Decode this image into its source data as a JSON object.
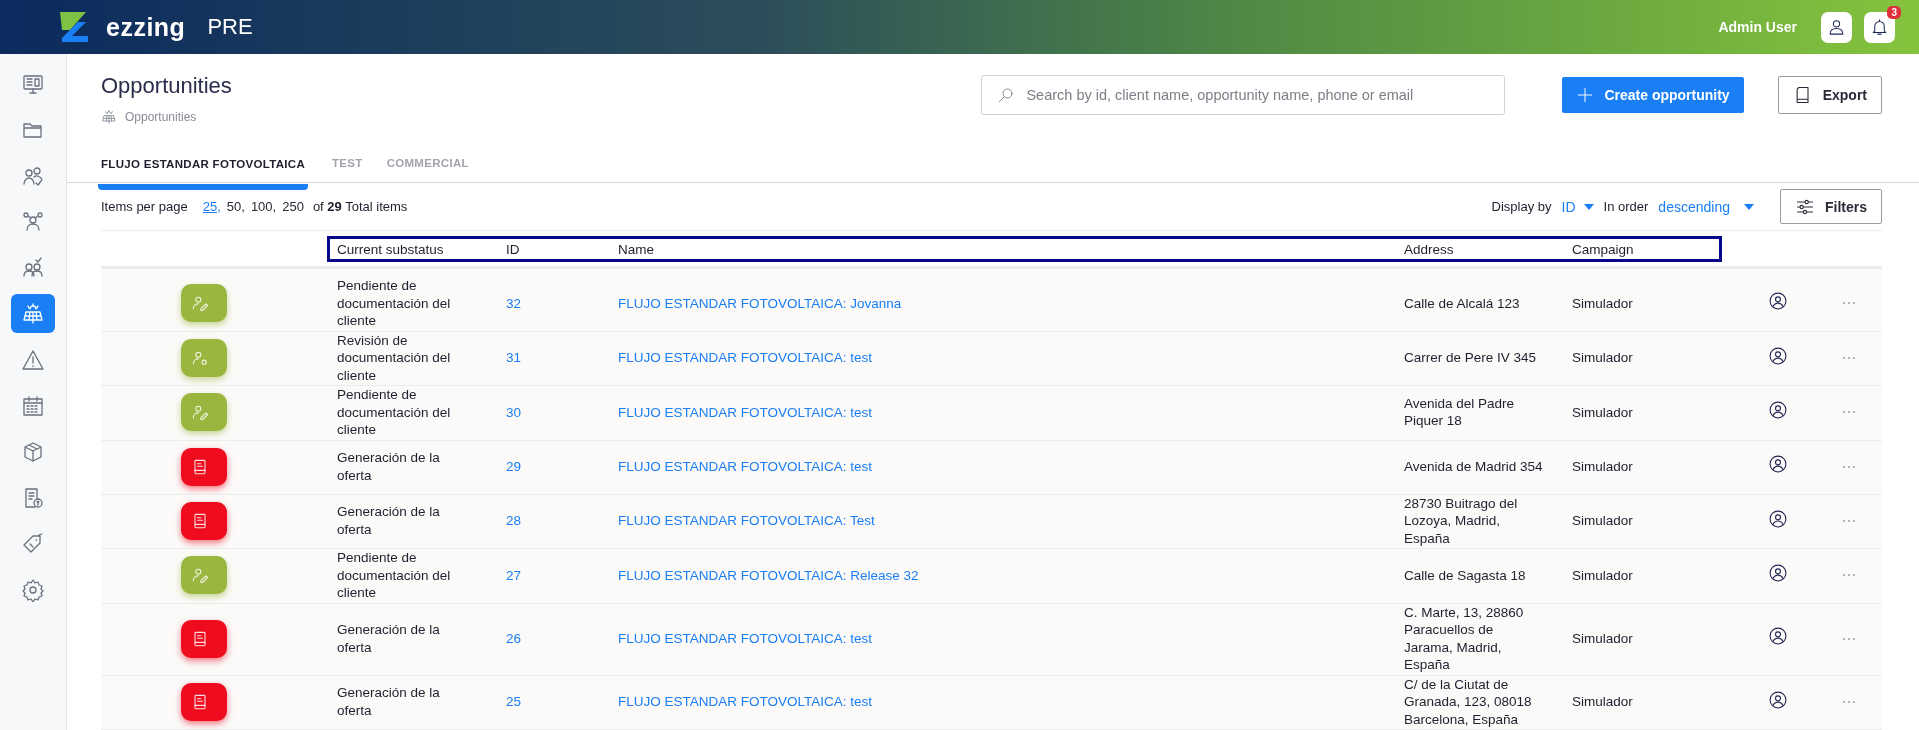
{
  "header": {
    "brand": "ezzing",
    "environment": "PRE",
    "user_name": "Admin User",
    "notification_count": "3"
  },
  "sidebar": {
    "items": [
      {
        "selected": false
      },
      {
        "selected": false
      },
      {
        "selected": false
      },
      {
        "selected": false
      },
      {
        "selected": false
      },
      {
        "selected": true
      },
      {
        "selected": false
      },
      {
        "selected": false
      },
      {
        "selected": false
      },
      {
        "selected": false
      },
      {
        "selected": false
      },
      {
        "selected": false
      }
    ]
  },
  "page": {
    "title": "Opportunities",
    "breadcrumb": "Opportunities"
  },
  "search": {
    "placeholder": "Search by id, client name, opportunity name, phone or email"
  },
  "buttons": {
    "create": "Create opportunity",
    "export": "Export",
    "filters": "Filters"
  },
  "tabs": [
    {
      "label": "FLUJO ESTANDAR FOTOVOLTAICA",
      "selected": true
    },
    {
      "label": "TEST",
      "selected": false
    },
    {
      "label": "COMMERCIAL",
      "selected": false
    }
  ],
  "pagination": {
    "label": "Items per page",
    "options": [
      {
        "label": "25,",
        "selected": true
      },
      {
        "label": "50,",
        "selected": false
      },
      {
        "label": "100,",
        "selected": false
      },
      {
        "label": "250",
        "selected": false
      }
    ],
    "total": "of **29** Total items"
  },
  "sorting": {
    "display_label": "Display by",
    "display_value": "ID",
    "order_label": "In order",
    "order_value": "descending"
  },
  "table": {
    "columns": [
      "Current substatus",
      "ID",
      "Name",
      "Address",
      "Campaign"
    ],
    "rows": [
      {
        "kind": "pending",
        "substatus": "Pendiente de documentación del cliente",
        "id": "32",
        "name": "FLUJO ESTANDAR FOTOVOLTAICA: Jovanna",
        "address": "Calle de Alcalá 123",
        "campaign": "Simulador"
      },
      {
        "kind": "review",
        "substatus": "Revisión de documentación del cliente",
        "id": "31",
        "name": "FLUJO ESTANDAR FOTOVOLTAICA: test",
        "address": "Carrer de Pere IV 345",
        "campaign": "Simulador"
      },
      {
        "kind": "pending",
        "substatus": "Pendiente de documentación del cliente",
        "id": "30",
        "name": "FLUJO ESTANDAR FOTOVOLTAICA: test",
        "address": "Avenida del Padre Piquer 18",
        "campaign": "Simulador"
      },
      {
        "kind": "offer",
        "substatus": "Generación de la oferta",
        "id": "29",
        "name": "FLUJO ESTANDAR FOTOVOLTAICA: test",
        "address": "Avenida de Madrid 354",
        "campaign": "Simulador"
      },
      {
        "kind": "offer",
        "substatus": "Generación de la oferta",
        "id": "28",
        "name": "FLUJO ESTANDAR FOTOVOLTAICA: Test",
        "address": "28730 Buitrago del Lozoya, Madrid, España",
        "campaign": "Simulador"
      },
      {
        "kind": "pending",
        "substatus": "Pendiente de documentación del cliente",
        "id": "27",
        "name": "FLUJO ESTANDAR FOTOVOLTAICA: Release 32",
        "address": "Calle de Sagasta 18",
        "campaign": "Simulador"
      },
      {
        "kind": "offer",
        "substatus": "Generación de la oferta",
        "id": "26",
        "name": "FLUJO ESTANDAR FOTOVOLTAICA: test",
        "address": "C. Marte, 13, 28860 Paracuellos de Jarama, Madrid, España",
        "campaign": "Simulador"
      },
      {
        "kind": "offer",
        "substatus": "Generación de la oferta",
        "id": "25",
        "name": "FLUJO ESTANDAR FOTOVOLTAICA: test",
        "address": "C/ de la Ciutat de Granada, 123, 08018 Barcelona, España",
        "campaign": "Simulador"
      }
    ]
  }
}
